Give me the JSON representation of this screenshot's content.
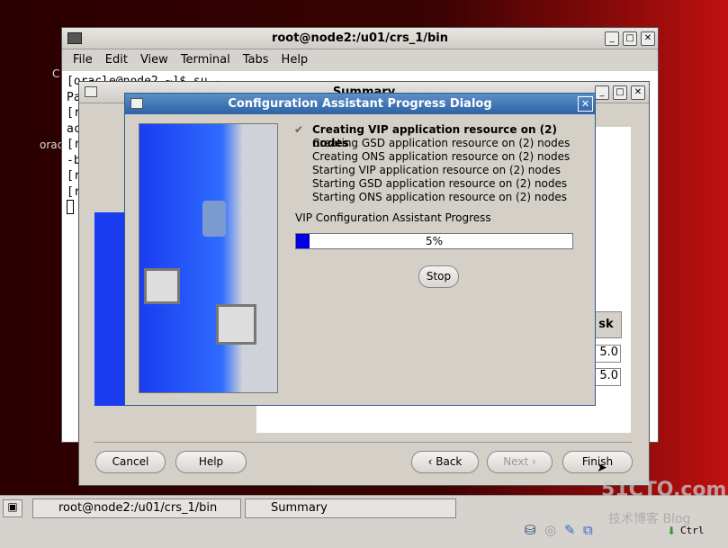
{
  "desktop": {
    "icon_labels": [
      "C",
      "orac"
    ]
  },
  "terminal": {
    "title": "root@node2:/u01/crs_1/bin",
    "menu": [
      "File",
      "Edit",
      "View",
      "Terminal",
      "Tabs",
      "Help"
    ],
    "lines": [
      "[oracle@node2 ~]$ su -",
      "Pa",
      "[r",
      "ac",
      "[r",
      "-b",
      "[r",
      "[r"
    ]
  },
  "summary": {
    "title": "Summary",
    "table_header": "sk",
    "table_values": [
      "5.0",
      "5.0"
    ],
    "buttons": {
      "cancel": "Cancel",
      "help": "Help",
      "back": "Back",
      "next": "Next",
      "finish": "Finish"
    }
  },
  "dialog": {
    "title": "Configuration Assistant Progress Dialog",
    "steps": [
      "Creating VIP application resource on (2) nodes",
      "Creating GSD application resource on (2) nodes",
      "Creating ONS application resource on (2) nodes",
      "Starting VIP application resource on (2) nodes",
      "Starting GSD application resource on (2) nodes",
      "Starting ONS application resource on (2) nodes"
    ],
    "progress_label": "VIP Configuration Assistant Progress",
    "progress_percent": 5,
    "progress_text": "5%",
    "stop": "Stop",
    "accent": "#0000e0"
  },
  "taskbar": {
    "items": [
      "root@node2:/u01/crs_1/bin",
      "Summary"
    ]
  },
  "tray": {
    "ctrl_label": "Ctrl",
    "icons": [
      "disk-icon",
      "cd-icon",
      "pen-icon",
      "network-icon",
      "chip-icon",
      "arrow-icon"
    ]
  },
  "watermark": {
    "text": "51CTO.com 技术博客 Blog"
  }
}
